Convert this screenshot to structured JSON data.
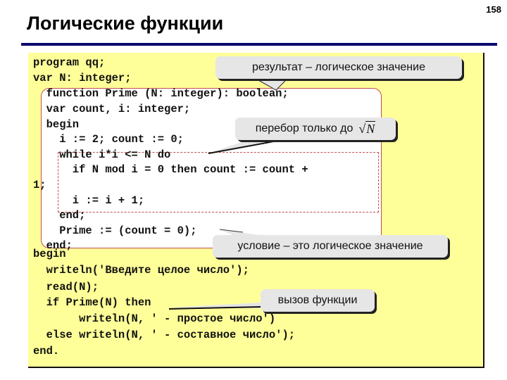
{
  "slide": {
    "page_number": "158",
    "title": "Логические функции"
  },
  "code": {
    "lines": [
      "program qq;",
      "var N: integer;",
      "  function Prime (N: integer): boolean;",
      "  var count, i: integer;",
      "  begin",
      "    i := 2; count := 0;",
      "    while i*i <= N do",
      "      if N mod i = 0 then count := count +",
      "1;",
      "      i := i + 1;",
      "    end;",
      "    Prime := (count = 0);",
      "  end;",
      "begin",
      "  writeln('Введите целое число');",
      "  read(N);",
      "  if Prime(N) then",
      "       writeln(N, ' - простое число')",
      "  else writeln(N, ' - составное число');",
      "end."
    ]
  },
  "callouts": {
    "result_type": "результат – логическое значение",
    "loop_limit": "перебор только до",
    "loop_limit_math": "N",
    "condition": "условие – это логическое значение",
    "function_call": "вызов функции"
  },
  "colors": {
    "panel_background": "#ffff99",
    "function_border": "#c0504d",
    "title_rule": "#0a0a6e",
    "callout_fill": "#e6e6e6"
  }
}
